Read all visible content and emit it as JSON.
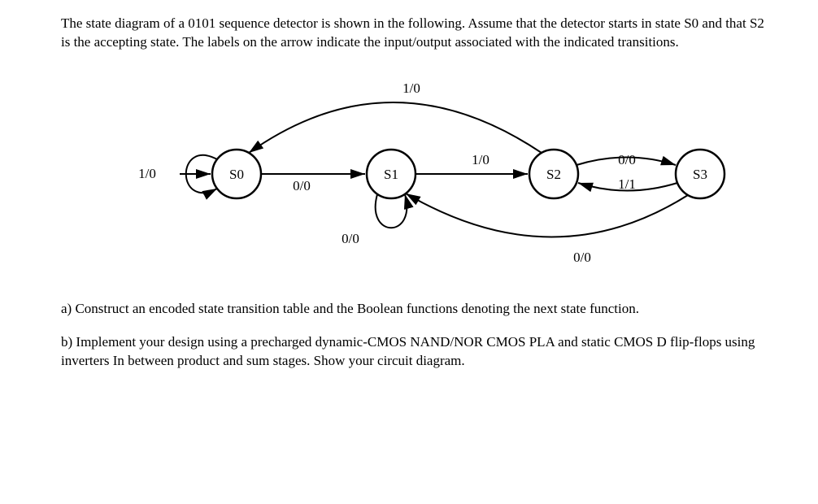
{
  "intro": "The state diagram of a 0101 sequence detector is shown in the following. Assume that the detector starts in state S0 and that S2 is the accepting state. The labels on the arrow indicate the input/output associated with the indicated transitions.",
  "diagram": {
    "states": {
      "s0": "S0",
      "s1": "S1",
      "s2": "S2",
      "s3": "S3"
    },
    "transitions": {
      "s0_loop": "1/0",
      "s0_s1": "0/0",
      "s1_loop": "0/0",
      "s1_s2": "1/0",
      "s2_s0": "1/0",
      "s2_s3": "0/0",
      "s3_s1": "0/0",
      "s3_s2": "1/1"
    }
  },
  "question_a": "a) Construct an encoded state transition table and the Boolean functions denoting the next state function.",
  "question_b": "b)  Implement your design using a precharged dynamic-CMOS NAND/NOR CMOS PLA and static CMOS D flip-flops using inverters In between product and sum stages.  Show your circuit diagram."
}
